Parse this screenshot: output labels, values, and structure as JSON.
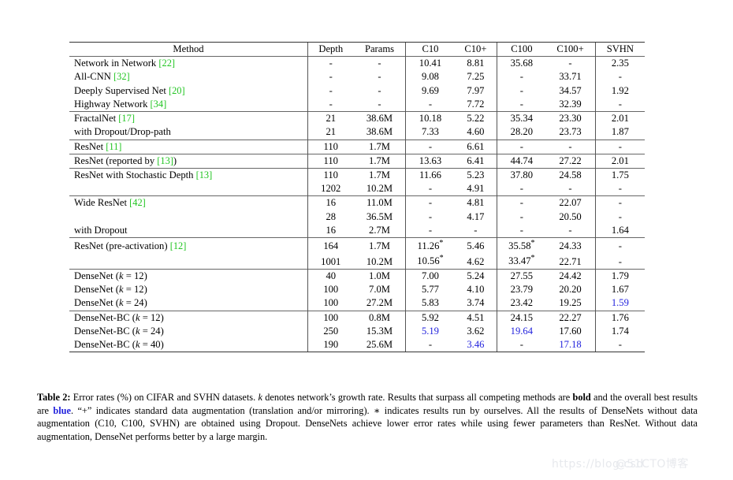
{
  "colors": {
    "citation_green": "#22c522",
    "highlight_blue": "#2222dd",
    "text": "#000000",
    "rule": "#333333",
    "watermark": "#e7e9ed"
  },
  "table": {
    "columns": [
      {
        "key": "method",
        "label": "Method"
      },
      {
        "key": "depth",
        "label": "Depth"
      },
      {
        "key": "params",
        "label": "Params"
      },
      {
        "key": "c10",
        "label": "C10"
      },
      {
        "key": "c10plus",
        "label": "C10+"
      },
      {
        "key": "c100",
        "label": "C100"
      },
      {
        "key": "c100plus",
        "label": "C100+"
      },
      {
        "key": "svhn",
        "label": "SVHN"
      }
    ],
    "groups": [
      {
        "rows": [
          {
            "method": "Network in Network",
            "cite": "[22]",
            "depth": "-",
            "params": "-",
            "c10": "10.41",
            "c10plus": "8.81",
            "c100": "35.68",
            "c100plus": "-",
            "svhn": "2.35"
          },
          {
            "method": "All-CNN",
            "cite": "[32]",
            "depth": "-",
            "params": "-",
            "c10": "9.08",
            "c10plus": "7.25",
            "c100": "-",
            "c100plus": "33.71",
            "svhn": "-"
          },
          {
            "method": "Deeply Supervised Net",
            "cite": "[20]",
            "depth": "-",
            "params": "-",
            "c10": "9.69",
            "c10plus": "7.97",
            "c100": "-",
            "c100plus": "34.57",
            "svhn": "1.92"
          },
          {
            "method": "Highway Network",
            "cite": "[34]",
            "depth": "-",
            "params": "-",
            "c10": "-",
            "c10plus": "7.72",
            "c100": "-",
            "c100plus": "32.39",
            "svhn": "-"
          }
        ]
      },
      {
        "rows": [
          {
            "method": "FractalNet",
            "cite": "[17]",
            "depth": "21",
            "params": "38.6M",
            "c10": "10.18",
            "c10plus": "5.22",
            "c100": "35.34",
            "c100plus": "23.30",
            "svhn": "2.01"
          },
          {
            "method": "with Dropout/Drop-path",
            "cite": "",
            "depth": "21",
            "params": "38.6M",
            "c10": "7.33",
            "c10plus": "4.60",
            "c100": "28.20",
            "c100plus": "23.73",
            "svhn": "1.87"
          }
        ]
      },
      {
        "rows": [
          {
            "method": "ResNet",
            "cite": "[11]",
            "depth": "110",
            "params": "1.7M",
            "c10": "-",
            "c10plus": "6.61",
            "c100": "-",
            "c100plus": "-",
            "svhn": "-"
          }
        ]
      },
      {
        "rows": [
          {
            "method": "ResNet (reported by [13])",
            "cite": "",
            "cite_inline": "[13]",
            "depth": "110",
            "params": "1.7M",
            "c10": "13.63",
            "c10plus": "6.41",
            "c100": "44.74",
            "c100plus": "27.22",
            "svhn": "2.01"
          }
        ]
      },
      {
        "rows": [
          {
            "method": "ResNet with Stochastic Depth",
            "cite": "[13]",
            "depth": "110",
            "params": "1.7M",
            "c10": "11.66",
            "c10plus": "5.23",
            "c100": "37.80",
            "c100plus": "24.58",
            "svhn": "1.75"
          },
          {
            "method": "",
            "cite": "",
            "depth": "1202",
            "params": "10.2M",
            "c10": "-",
            "c10plus": "4.91",
            "c100": "-",
            "c100plus": "-",
            "svhn": "-"
          }
        ]
      },
      {
        "rows": [
          {
            "method": "Wide ResNet",
            "cite": "[42]",
            "depth": "16",
            "params": "11.0M",
            "c10": "-",
            "c10plus": "4.81",
            "c100": "-",
            "c100plus": "22.07",
            "svhn": "-"
          },
          {
            "method": "",
            "cite": "",
            "depth": "28",
            "params": "36.5M",
            "c10": "-",
            "c10plus": "4.17",
            "c100": "-",
            "c100plus": "20.50",
            "svhn": "-"
          },
          {
            "method": "with Dropout",
            "cite": "",
            "depth": "16",
            "params": "2.7M",
            "c10": "-",
            "c10plus": "-",
            "c100": "-",
            "c100plus": "-",
            "svhn": "1.64"
          }
        ]
      },
      {
        "rows": [
          {
            "method": "ResNet (pre-activation)",
            "cite": "[12]",
            "depth": "164",
            "params": "1.7M",
            "c10": "11.26*",
            "c10plus": "5.46",
            "c100": "35.58*",
            "c100plus": "24.33",
            "svhn": "-"
          },
          {
            "method": "",
            "cite": "",
            "depth": "1001",
            "params": "10.2M",
            "c10": "10.56*",
            "c10plus": "4.62",
            "c100": "33.47*",
            "c100plus": "22.71",
            "svhn": "-"
          }
        ]
      },
      {
        "rows": [
          {
            "method": "DenseNet (k = 12)",
            "math": true,
            "name": "DenseNet",
            "k": "12",
            "cite": "",
            "depth": "40",
            "params": "1.0M",
            "c10": "7.00",
            "c10_style": "bold",
            "c10plus": "5.24",
            "c100": "27.55",
            "c100_style": "bold",
            "c100plus": "24.42",
            "svhn": "1.79"
          },
          {
            "method": "DenseNet (k = 12)",
            "math": true,
            "name": "DenseNet",
            "k": "12",
            "cite": "",
            "depth": "100",
            "params": "7.0M",
            "c10": "5.77",
            "c10_style": "bold",
            "c10plus": "4.10",
            "c10plus_style": "bold",
            "c100": "23.79",
            "c100_style": "bold",
            "c100plus": "20.20",
            "c100plus_style": "bold",
            "svhn": "1.67"
          },
          {
            "method": "DenseNet (k = 24)",
            "math": true,
            "name": "DenseNet",
            "k": "24",
            "cite": "",
            "depth": "100",
            "params": "27.2M",
            "c10": "5.83",
            "c10_style": "bold",
            "c10plus": "3.74",
            "c10plus_style": "bold",
            "c100": "23.42",
            "c100_style": "bold",
            "c100plus": "19.25",
            "c100plus_style": "bold",
            "svhn": "1.59",
            "svhn_style": "blue"
          }
        ]
      },
      {
        "rows": [
          {
            "method": "DenseNet-BC (k = 12)",
            "math": true,
            "name": "DenseNet-BC",
            "k": "12",
            "cite": "",
            "depth": "100",
            "params": "0.8M",
            "c10": "5.92",
            "c10_style": "bold",
            "c10plus": "4.51",
            "c100": "24.15",
            "c100_style": "bold",
            "c100plus": "22.27",
            "svhn": "1.76"
          },
          {
            "method": "DenseNet-BC (k = 24)",
            "math": true,
            "name": "DenseNet-BC",
            "k": "24",
            "cite": "",
            "depth": "250",
            "params": "15.3M",
            "c10": "5.19",
            "c10_style": "blue",
            "c10plus": "3.62",
            "c10plus_style": "bold",
            "c100": "19.64",
            "c100_style": "blue",
            "c100plus": "17.60",
            "c100plus_style": "bold",
            "svhn": "1.74"
          },
          {
            "method": "DenseNet-BC (k = 40)",
            "math": true,
            "name": "DenseNet-BC",
            "k": "40",
            "cite": "",
            "depth": "190",
            "params": "25.6M",
            "c10": "-",
            "c10plus": "3.46",
            "c10plus_style": "blue",
            "c100": "-",
            "c100plus": "17.18",
            "c100plus_style": "blue",
            "svhn": "-"
          }
        ]
      }
    ]
  },
  "caption": {
    "label": "Table 2:",
    "part1": " Error rates (%) on CIFAR and SVHN datasets. ",
    "k_var": "k",
    "part2": " denotes network’s growth rate. Results that surpass all competing methods are ",
    "bold_word": "bold",
    "part3": " and the overall best results are ",
    "blue_word": "blue",
    "part4": ". “+” indicates standard data augmentation (translation and/or mirroring). ∗ indicates results run by ourselves. All the results of DenseNets without data augmentation (C10, C100, SVHN) are obtained using Dropout. DenseNets achieve lower error rates while using fewer parameters than ResNet. Without data augmentation, DenseNet performs better by a large margin."
  },
  "watermark": {
    "url": "https://blog.csd",
    "tag": "@51CTO博客"
  }
}
